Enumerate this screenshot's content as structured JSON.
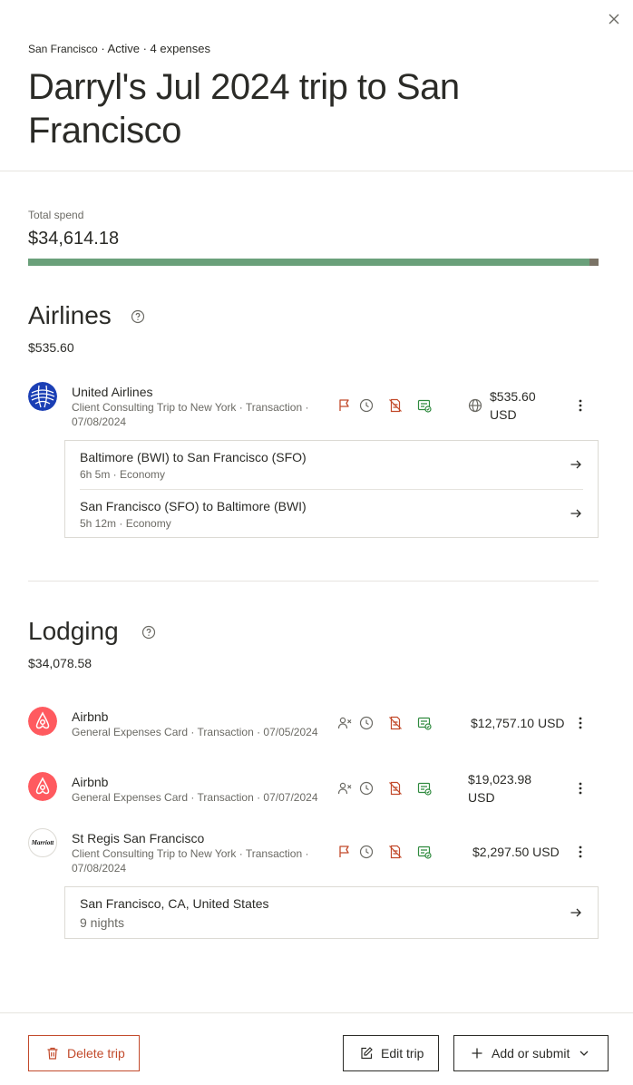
{
  "header": {
    "location": "San Francisco",
    "status": "Active",
    "expense_count": "4 expenses",
    "title": "Darryl's Jul 2024 trip to San Francisco"
  },
  "summary": {
    "total_label": "Total spend",
    "total_value": "$34,614.18",
    "bar": {
      "airlines_fraction": 0.0155,
      "lodging_fraction": 0.9845
    }
  },
  "airlines": {
    "title": "Airlines",
    "amount": "$535.60",
    "rows": [
      {
        "merchant": "United Airlines",
        "sub_line1": "Client Consulting Trip to New York · Transaction ·",
        "sub_line2": "07/08/2024",
        "amount_line1": "$535.60",
        "amount_line2": "USD",
        "details": [
          {
            "title": "Baltimore (BWI) to San Francisco (SFO)",
            "sub": "6h 5m · Economy"
          },
          {
            "title": "San Francisco (SFO) to Baltimore (BWI)",
            "sub": "5h 12m · Economy"
          }
        ]
      }
    ]
  },
  "lodging": {
    "title": "Lodging",
    "amount": "$34,078.58",
    "rows": [
      {
        "merchant": "Airbnb",
        "sub_line1": "General Expenses Card · Transaction · 07/05/2024",
        "amount": "$12,757.10 USD"
      },
      {
        "merchant": "Airbnb",
        "sub_line1": "General Expenses Card · Transaction · 07/07/2024",
        "amount_line1": "$19,023.98",
        "amount_line2": "USD"
      },
      {
        "merchant": "St Regis San Francisco",
        "logo_text": "Marriott",
        "sub_line1": "Client Consulting Trip to New York · Transaction ·",
        "sub_line2": "07/08/2024",
        "amount": "$2,297.50 USD",
        "details": [
          {
            "title": "San Francisco, CA, United States",
            "sub": "9 nights"
          }
        ]
      }
    ]
  },
  "footer": {
    "delete_label": "Delete trip",
    "edit_label": "Edit trip",
    "add_label": "Add or submit"
  },
  "colors": {
    "text": "#2b2b27",
    "muted": "#6b6a64",
    "danger": "#c24a2b",
    "success": "#2f8a3e",
    "bar_green": "#6aa07a",
    "bar_gray": "#7a7366",
    "airbnb": "#ff5a5f",
    "united": "#1b3fb5"
  },
  "icons": [
    "close-icon",
    "help-icon",
    "flag-icon",
    "clock-icon",
    "no-receipt-icon",
    "approved-icon",
    "globe-icon",
    "user-x-icon",
    "kebab-icon",
    "arrow-right-icon",
    "trash-icon",
    "edit-icon",
    "plus-icon",
    "chevron-down-icon"
  ]
}
